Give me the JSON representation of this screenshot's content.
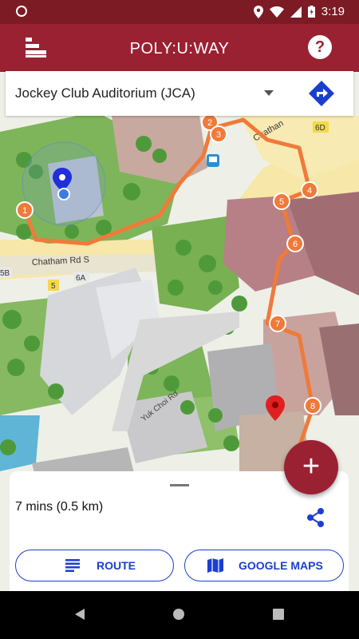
{
  "status_bar": {
    "time": "3:19"
  },
  "app_bar": {
    "title": "POLY:U:WAY",
    "help_symbol": "?"
  },
  "destination": {
    "selected": "Jockey Club Auditorium (JCA)"
  },
  "map": {
    "road_labels": [
      "Chatham Rd S",
      "Chathan",
      "Yuk Choi Rd"
    ],
    "zone_labels": [
      "6D",
      "5B",
      "5",
      "6A"
    ],
    "route_waypoints": [
      "1",
      "2",
      "3",
      "4",
      "5",
      "6",
      "7",
      "8"
    ]
  },
  "fab": {
    "symbol": "+"
  },
  "bottom_sheet": {
    "eta": "7 mins (0.5 km)",
    "route_button": "ROUTE",
    "google_maps_button": "GOOGLE MAPS"
  },
  "colors": {
    "brand": "#9a2132",
    "accent_blue": "#1a3fcf",
    "route": "#f07a3a"
  }
}
